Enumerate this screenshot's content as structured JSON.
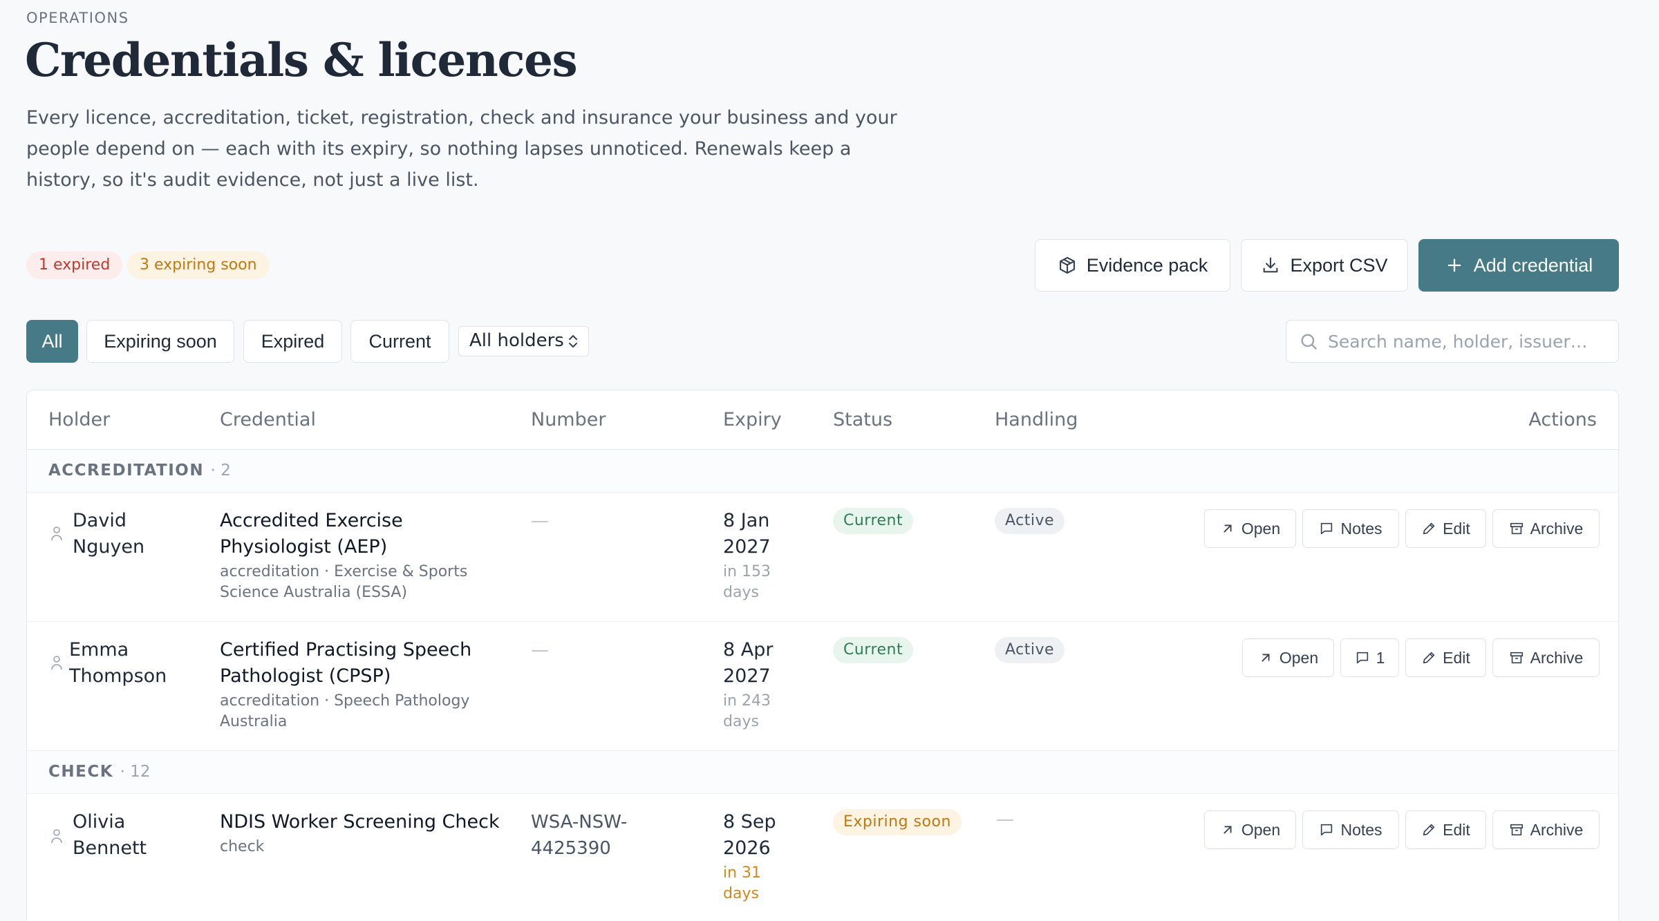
{
  "header": {
    "eyebrow": "OPERATIONS",
    "title": "Credentials & licences",
    "description": "Every licence, accreditation, ticket, registration, check and insurance your business and your people depend on — each with its expiry, so nothing lapses unnoticed. Renewals keep a history, so it's audit evidence, not just a live list."
  },
  "summary": {
    "expired": "1 expired",
    "expiring_soon": "3 expiring soon"
  },
  "toolbar": {
    "evidence_pack": "Evidence pack",
    "export_csv": "Export CSV",
    "add_credential": "Add credential"
  },
  "filters": {
    "all": "All",
    "expiring_soon": "Expiring soon",
    "expired": "Expired",
    "current": "Current",
    "holders_select": "All holders",
    "active_filter": "All"
  },
  "search": {
    "placeholder": "Search name, holder, issuer…",
    "value": ""
  },
  "table": {
    "columns": {
      "holder": "Holder",
      "credential": "Credential",
      "number": "Number",
      "expiry": "Expiry",
      "status": "Status",
      "handling": "Handling",
      "actions": "Actions"
    },
    "groups": [
      {
        "label": "ACCREDITATION",
        "count": "· 2",
        "rows": [
          {
            "holder": "David Nguyen",
            "credential": "Accredited Exercise Physiologist (AEP)",
            "meta": "accreditation · Exercise & Sports Science Australia (ESSA)",
            "number": "—",
            "expiry_date": "8 Jan 2027",
            "expiry_relative": "in 153 days",
            "status": "Current",
            "handling": "Active",
            "actions": {
              "open": "Open",
              "notes": "Notes",
              "edit": "Edit",
              "archive": "Archive"
            }
          },
          {
            "holder": "Emma Thompson",
            "credential": "Certified Practising Speech Pathologist (CPSP)",
            "meta": "accreditation · Speech Pathology Australia",
            "number": "—",
            "expiry_date": "8 Apr 2027",
            "expiry_relative": "in 243 days",
            "status": "Current",
            "handling": "Active",
            "actions": {
              "open": "Open",
              "notes": "1",
              "edit": "Edit",
              "archive": "Archive"
            }
          }
        ]
      },
      {
        "label": "CHECK",
        "count": "· 12",
        "rows": [
          {
            "holder": "Olivia Bennett",
            "credential": "NDIS Worker Screening Check",
            "meta": "check",
            "number": "WSA-NSW-4425390",
            "expiry_date": "8 Sep 2026",
            "expiry_relative": "in 31 days",
            "status": "Expiring soon",
            "handling": "—",
            "actions": {
              "open": "Open",
              "notes": "Notes",
              "edit": "Edit",
              "archive": "Archive"
            }
          }
        ]
      }
    ]
  },
  "colors": {
    "accent": "#457a86",
    "expired": "#c0392b",
    "warning": "#c2780f",
    "current": "#2f7d55"
  }
}
